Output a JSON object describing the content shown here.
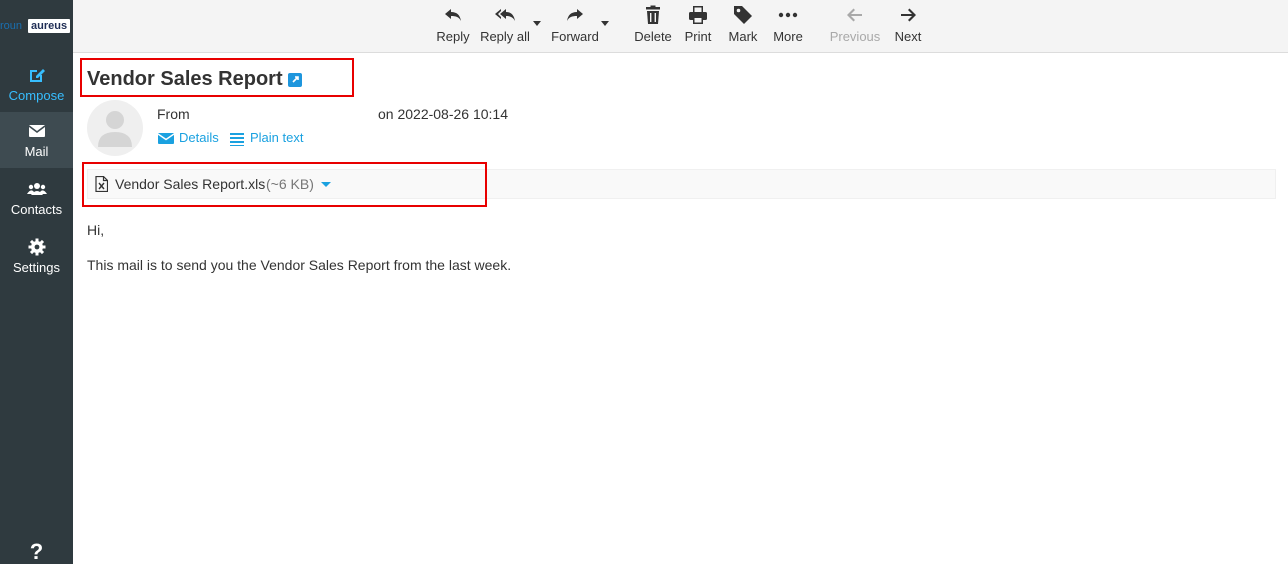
{
  "logo": {
    "part1": "roun",
    "part2": "aureus"
  },
  "nav": {
    "compose": "Compose",
    "mail": "Mail",
    "contacts": "Contacts",
    "settings": "Settings",
    "help": "?"
  },
  "toolbar": {
    "reply": "Reply",
    "reply_all": "Reply all",
    "forward": "Forward",
    "delete": "Delete",
    "print": "Print",
    "mark": "Mark",
    "more": "More",
    "previous": "Previous",
    "next": "Next"
  },
  "message": {
    "subject": "Vendor Sales Report",
    "from_label": "From",
    "date": "on 2022-08-26 10:14",
    "details_link": "Details",
    "plain_text_link": "Plain text"
  },
  "attachment": {
    "name": "Vendor Sales Report.xls",
    "size": "(~6 KB)"
  },
  "body": {
    "greeting": "Hi,",
    "text": "This mail is to send you the Vendor Sales Report from the last week."
  },
  "colors": {
    "accent": "#37beff",
    "link": "#1aa1e0",
    "sidebar": "#2f3a3f",
    "highlight": "#e80000"
  }
}
